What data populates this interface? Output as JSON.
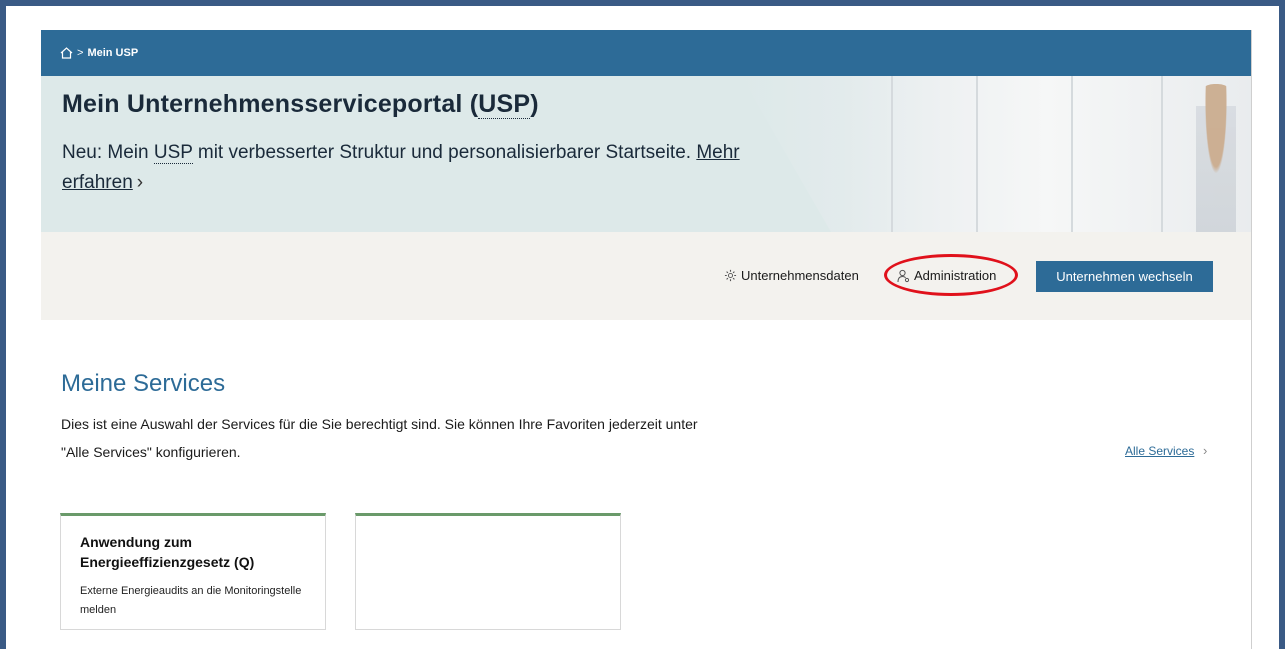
{
  "breadcrumb": {
    "home_icon": "home-icon",
    "separator": ">",
    "current": "Mein USP"
  },
  "hero": {
    "title_prefix": "Mein Unternehmensserviceportal (",
    "title_abbr": "USP",
    "title_suffix": ")",
    "teaser_prefix": "Neu: Mein ",
    "teaser_abbr": "USP",
    "teaser_text": " mit verbesserter Struktur und personalisierbarer Startseite. ",
    "teaser_link": "Mehr erfahren",
    "teaser_chevron": "›"
  },
  "toolbar": {
    "company_data_label": "Unternehmensdaten",
    "company_data_icon": "gear-icon",
    "administration_label": "Administration",
    "administration_icon": "user-admin-icon",
    "switch_company_label": "Unternehmen wechseln"
  },
  "services": {
    "title": "Meine Services",
    "description": "Dies ist eine Auswahl der Services für die Sie berechtigt sind. Sie können Ihre Favoriten jederzeit unter \"Alle Services\" konfigurieren.",
    "all_services_label": "Alle Services",
    "all_services_chevron": "›",
    "cards": [
      {
        "title": "Anwendung zum Energieeffizienzgesetz (Q)",
        "description": "Externe Energieaudits an die Monitoringstelle melden"
      },
      {
        "title": "",
        "description": ""
      }
    ]
  },
  "colors": {
    "primary_blue": "#2d6b97",
    "hero_bg": "#dde9e9",
    "toolbar_bg": "#f3f2ee",
    "card_accent": "#6a9a6a",
    "highlight_red": "#e0111b"
  }
}
